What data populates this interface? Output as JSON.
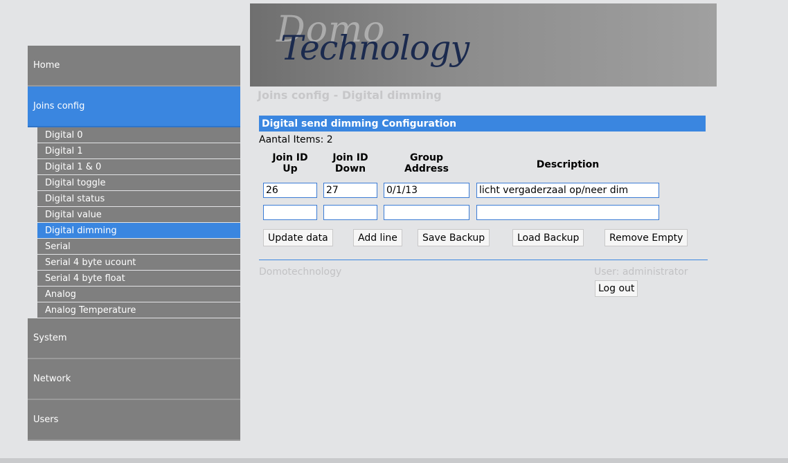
{
  "sidebar": {
    "top_items": [
      {
        "label": "Home"
      },
      {
        "label": "Joins config"
      }
    ],
    "sub_items": [
      {
        "label": "Digital 0"
      },
      {
        "label": "Digital 1"
      },
      {
        "label": "Digital 1 & 0"
      },
      {
        "label": "Digital toggle"
      },
      {
        "label": "Digital status"
      },
      {
        "label": "Digital value"
      },
      {
        "label": "Digital dimming"
      },
      {
        "label": "Serial"
      },
      {
        "label": "Serial 4 byte ucount"
      },
      {
        "label": "Serial 4 byte float"
      },
      {
        "label": "Analog"
      },
      {
        "label": "Analog Temperature"
      }
    ],
    "bottom_items": [
      {
        "label": "System"
      },
      {
        "label": "Network"
      },
      {
        "label": "Users"
      }
    ]
  },
  "banner": {
    "logo_top": "Domo",
    "logo_bottom": "Technology"
  },
  "page_title": "Joins config - Digital dimming",
  "section_title": "Digital send dimming Configuration",
  "item_count": "Aantal Items: 2",
  "table": {
    "col_join_up_line1": "Join ID",
    "col_join_up_line2": "Up",
    "col_join_down_line1": "Join ID",
    "col_join_down_line2": "Down",
    "col_group_line1": "Group",
    "col_group_line2": "Address",
    "col_description": "Description",
    "rows": [
      {
        "up": "26",
        "down": "27",
        "group": "0/1/13",
        "description": "licht vergaderzaal op/neer dim"
      },
      {
        "up": "",
        "down": "",
        "group": "",
        "description": ""
      }
    ]
  },
  "buttons": {
    "update": "Update data",
    "add_line": "Add line",
    "save_backup": "Save Backup",
    "load_backup": "Load Backup",
    "remove_empty": "Remove Empty"
  },
  "footer": {
    "brand": "Domotechnology",
    "user": "User: administrator",
    "logout": "Log out"
  },
  "colors": {
    "accent": "#3a86e0",
    "menu_gray": "#7f7f7f",
    "background": "#e3e4e6"
  }
}
